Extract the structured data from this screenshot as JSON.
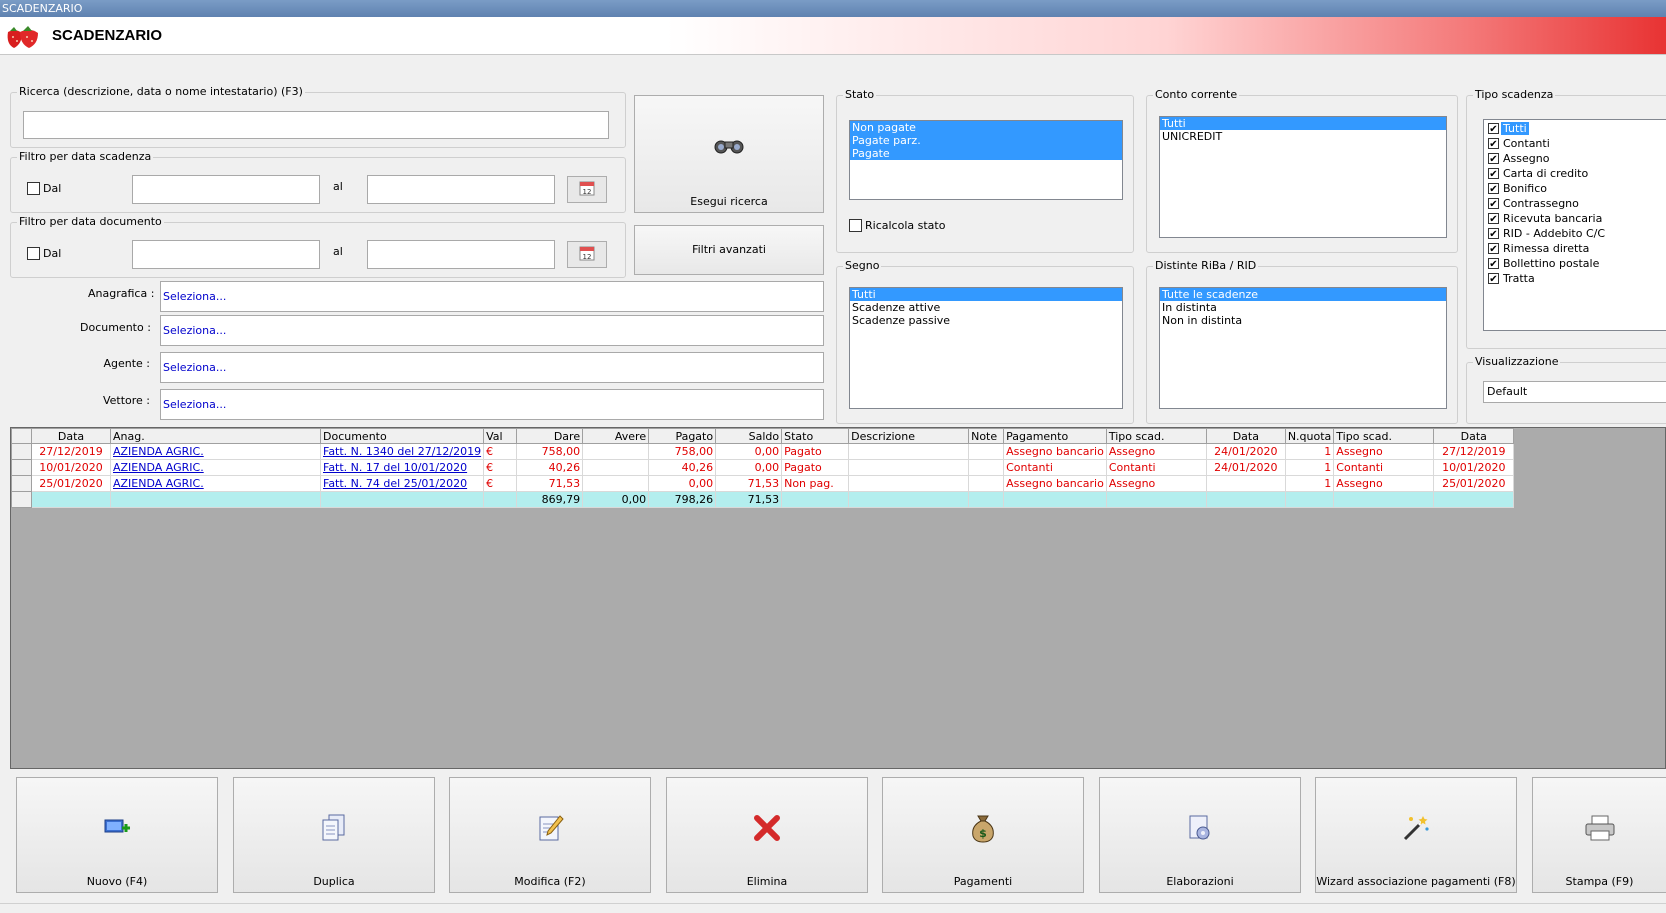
{
  "window": {
    "title": "SCADENZARIO"
  },
  "header": {
    "title": "SCADENZARIO",
    "logo_icon": "strawberry-icon"
  },
  "search": {
    "label": "Ricerca (descrizione, data o nome intestatario) (F3)",
    "value": "",
    "button_label": "Esegui ricerca",
    "advanced_label": "Filtri avanzati"
  },
  "filter_scadenza": {
    "label": "Filtro per data scadenza",
    "check_label": "Dal",
    "checked": false,
    "to_label": "al",
    "from_value": "",
    "to_value": ""
  },
  "filter_documento": {
    "label": "Filtro per data documento",
    "check_label": "Dal",
    "checked": false,
    "to_label": "al",
    "from_value": "",
    "to_value": ""
  },
  "selectors": [
    {
      "label": "Anagrafica :",
      "value": "Seleziona..."
    },
    {
      "label": "Documento :",
      "value": "Seleziona..."
    },
    {
      "label": "Agente :",
      "value": "Seleziona..."
    },
    {
      "label": "Vettore :",
      "value": "Seleziona..."
    }
  ],
  "stato": {
    "label": "Stato",
    "items": [
      {
        "text": "Non pagate",
        "selected": true
      },
      {
        "text": "Pagate parz.",
        "selected": true
      },
      {
        "text": "Pagate",
        "selected": true
      }
    ],
    "recalc_label": "Ricalcola stato",
    "recalc_checked": false
  },
  "segno": {
    "label": "Segno",
    "items": [
      {
        "text": "Tutti",
        "selected": true
      },
      {
        "text": "Scadenze attive",
        "selected": false
      },
      {
        "text": "Scadenze passive",
        "selected": false
      }
    ]
  },
  "conto": {
    "label": "Conto corrente",
    "items": [
      {
        "text": "Tutti",
        "selected": true
      },
      {
        "text": "UNICREDIT",
        "selected": false
      }
    ]
  },
  "distinte": {
    "label": "Distinte RiBa / RID",
    "items": [
      {
        "text": "Tutte le scadenze",
        "selected": true
      },
      {
        "text": "In distinta",
        "selected": false
      },
      {
        "text": "Non in distinta",
        "selected": false
      }
    ]
  },
  "tipo_scadenza": {
    "label": "Tipo scadenza",
    "items": [
      {
        "text": "Tutti",
        "checked": true,
        "selected": true
      },
      {
        "text": "Contanti",
        "checked": true
      },
      {
        "text": "Assegno",
        "checked": true
      },
      {
        "text": "Carta di credito",
        "checked": true
      },
      {
        "text": "Bonifico",
        "checked": true
      },
      {
        "text": "Contrassegno",
        "checked": true
      },
      {
        "text": "Ricevuta bancaria",
        "checked": true
      },
      {
        "text": "RID - Addebito C/C",
        "checked": true
      },
      {
        "text": "Rimessa diretta",
        "checked": true
      },
      {
        "text": "Bollettino postale",
        "checked": true
      },
      {
        "text": "Tratta",
        "checked": true
      }
    ]
  },
  "visualizzazione": {
    "label": "Visualizzazione",
    "value": "Default"
  },
  "grid": {
    "columns": [
      "Data",
      "Anag.",
      "Documento",
      "Val",
      "Dare",
      "Avere",
      "Pagato",
      "Saldo",
      "Stato",
      "Descrizione",
      "Note",
      "Pagamento",
      "Tipo scad.",
      "Data",
      "N.quota",
      "Tipo scad.",
      "Data"
    ],
    "rows": [
      [
        "27/12/2019",
        "AZIENDA AGRIC.",
        "Fatt. N. 1340 del 27/12/2019",
        "€",
        "758,00",
        "",
        "758,00",
        "0,00",
        "Pagato",
        "",
        "",
        "Assegno bancario",
        "Assegno",
        "24/01/2020",
        "1",
        "Assegno",
        "27/12/2019"
      ],
      [
        "10/01/2020",
        "AZIENDA AGRIC.",
        "Fatt. N. 17 del 10/01/2020",
        "€",
        "40,26",
        "",
        "40,26",
        "0,00",
        "Pagato",
        "",
        "",
        "Contanti",
        "Contanti",
        "24/01/2020",
        "1",
        "Contanti",
        "10/01/2020"
      ],
      [
        "25/01/2020",
        "AZIENDA AGRIC.",
        "Fatt. N. 74 del 25/01/2020",
        "€",
        "71,53",
        "",
        "0,00",
        "71,53",
        "Non pag.",
        "",
        "",
        "Assegno bancario",
        "Assegno",
        "",
        "1",
        "Assegno",
        "25/01/2020"
      ]
    ],
    "totals": [
      "",
      "",
      "",
      "",
      "869,79",
      "0,00",
      "798,26",
      "71,53",
      "",
      "",
      "",
      "",
      "",
      "",
      "",
      "",
      ""
    ],
    "text_color": "#e00000",
    "link_color": "#0000cc",
    "total_bg": "#b3eeee"
  },
  "actions": [
    {
      "label": "Nuovo (F4)",
      "icon": "new-record-icon"
    },
    {
      "label": "Duplica",
      "icon": "duplicate-icon"
    },
    {
      "label": "Modifica (F2)",
      "icon": "edit-icon"
    },
    {
      "label": "Elimina",
      "icon": "delete-icon"
    },
    {
      "label": "Pagamenti",
      "icon": "money-bag-icon"
    },
    {
      "label": "Elaborazioni",
      "icon": "process-icon"
    },
    {
      "label": "Wizard associazione pagamenti (F8)",
      "icon": "wizard-icon"
    },
    {
      "label": "Stampa (F9)",
      "icon": "printer-icon"
    }
  ]
}
